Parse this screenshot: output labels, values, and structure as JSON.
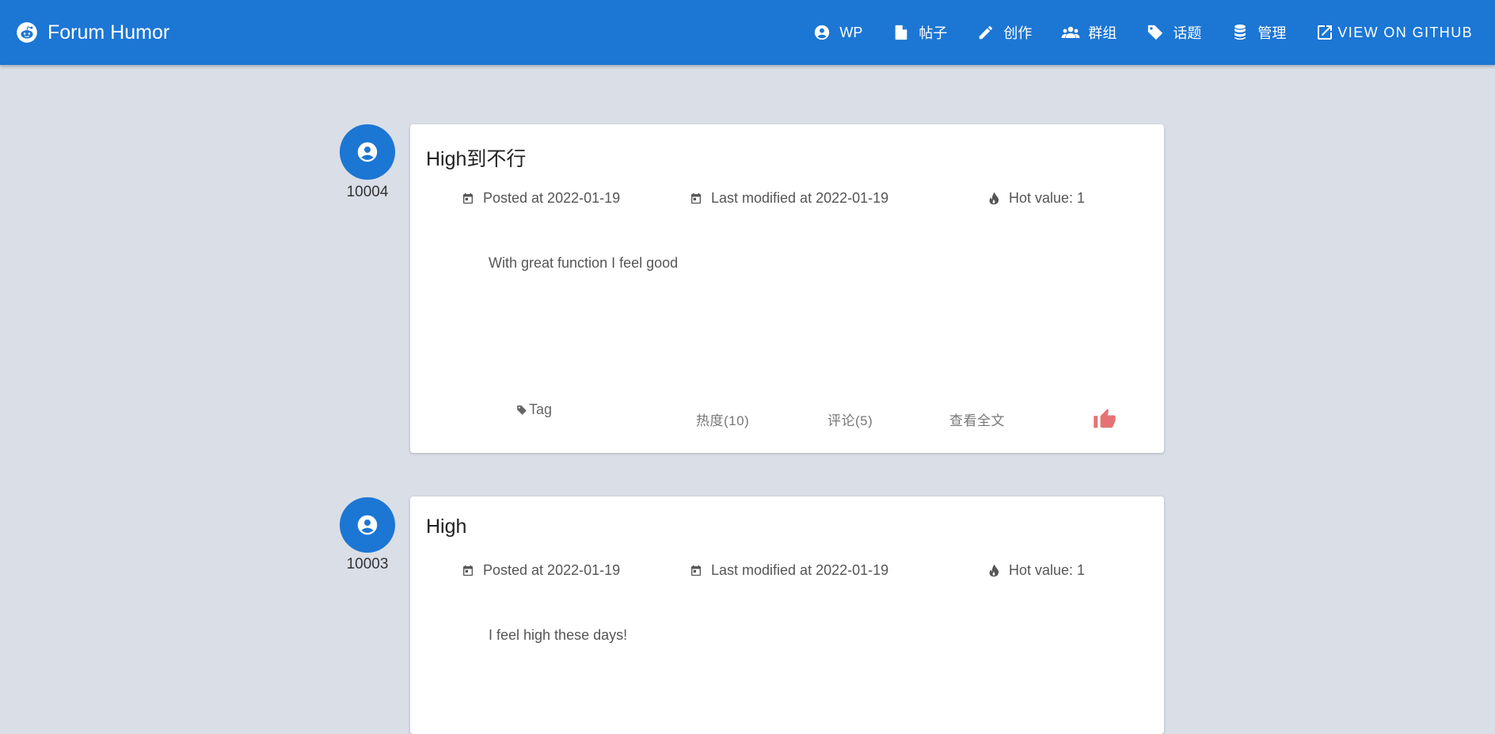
{
  "colors": {
    "primary": "#1c76d4",
    "background": "#dadee6",
    "like": "#e57373"
  },
  "brand": {
    "title": "Forum Humor",
    "icon": "reddit-alien-icon"
  },
  "nav": [
    {
      "label": "WP",
      "icon": "account-circle-icon"
    },
    {
      "label": "帖子",
      "icon": "file-icon"
    },
    {
      "label": "创作",
      "icon": "pencil-icon"
    },
    {
      "label": "群组",
      "icon": "account-group-icon"
    },
    {
      "label": "话题",
      "icon": "tag-icon"
    },
    {
      "label": "管理",
      "icon": "database-icon"
    },
    {
      "label": "VIEW ON GITHUB",
      "icon": "open-in-new-icon"
    }
  ],
  "posts": [
    {
      "user_id": "10004",
      "title": "High到不行",
      "posted": "Posted at 2022-01-19",
      "modified": "Last modified at 2022-01-19",
      "hot": "Hot value: 1",
      "content": "With great function I feel good",
      "tag": "Tag",
      "heat": "热度(10)",
      "comments": "评论(5)",
      "view_all": "查看全文"
    },
    {
      "user_id": "10003",
      "title": "High",
      "posted": "Posted at 2022-01-19",
      "modified": "Last modified at 2022-01-19",
      "hot": "Hot value: 1",
      "content": "I feel high these days!"
    }
  ]
}
